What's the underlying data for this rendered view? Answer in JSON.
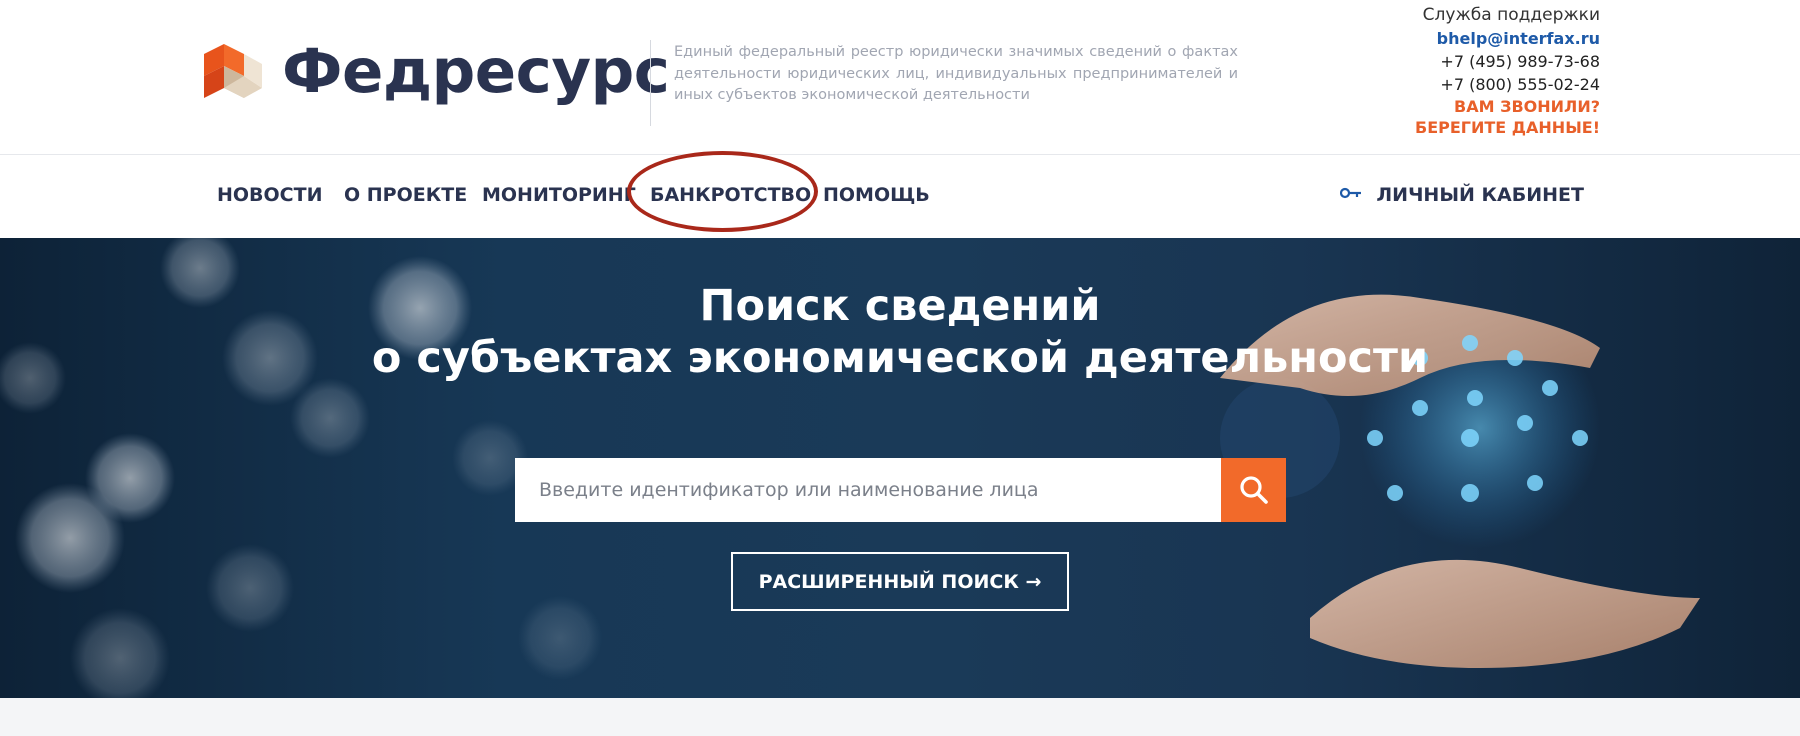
{
  "brand": {
    "name": "Федресурс",
    "tagline": "Единый федеральный реестр юридически значимых сведений о фактах деятельности юридических лиц, индивидуальных предпринимателей и иных субъектов экономической деятельности"
  },
  "support": {
    "title": "Служба поддержки",
    "email": "bhelp@interfax.ru",
    "phone1": "+7 (495) 989-73-68",
    "phone2": "+7 (800) 555-02-24",
    "warning_line1": "ВАМ ЗВОНИЛИ?",
    "warning_line2": "БЕРЕГИТЕ ДАННЫЕ!"
  },
  "nav": {
    "items": [
      {
        "label": "НОВОСТИ"
      },
      {
        "label": "О ПРОЕКТЕ"
      },
      {
        "label": "МОНИТОРИНГ"
      },
      {
        "label": "БАНКРОТСТВО",
        "highlighted": true
      },
      {
        "label": "ПОМОЩЬ"
      }
    ],
    "cabinet_label": "ЛИЧНЫЙ КАБИНЕТ"
  },
  "hero": {
    "title_line1": "Поиск сведений",
    "title_line2": "о субъектах экономической деятельности",
    "search_placeholder": "Введите идентификатор или наименование лица",
    "advanced_search_label": "РАСШИРЕННЫЙ ПОИСК  →"
  },
  "colors": {
    "accent": "#f26a2a",
    "brand_text": "#2a3350",
    "link": "#1e5aa8",
    "highlight_ring": "#a9281a",
    "hero_bg": "#173856"
  },
  "icons": {
    "logo": "fedresurs-cube-logo",
    "search": "search-icon",
    "key": "key-icon",
    "arrow": "arrow-right-icon"
  }
}
